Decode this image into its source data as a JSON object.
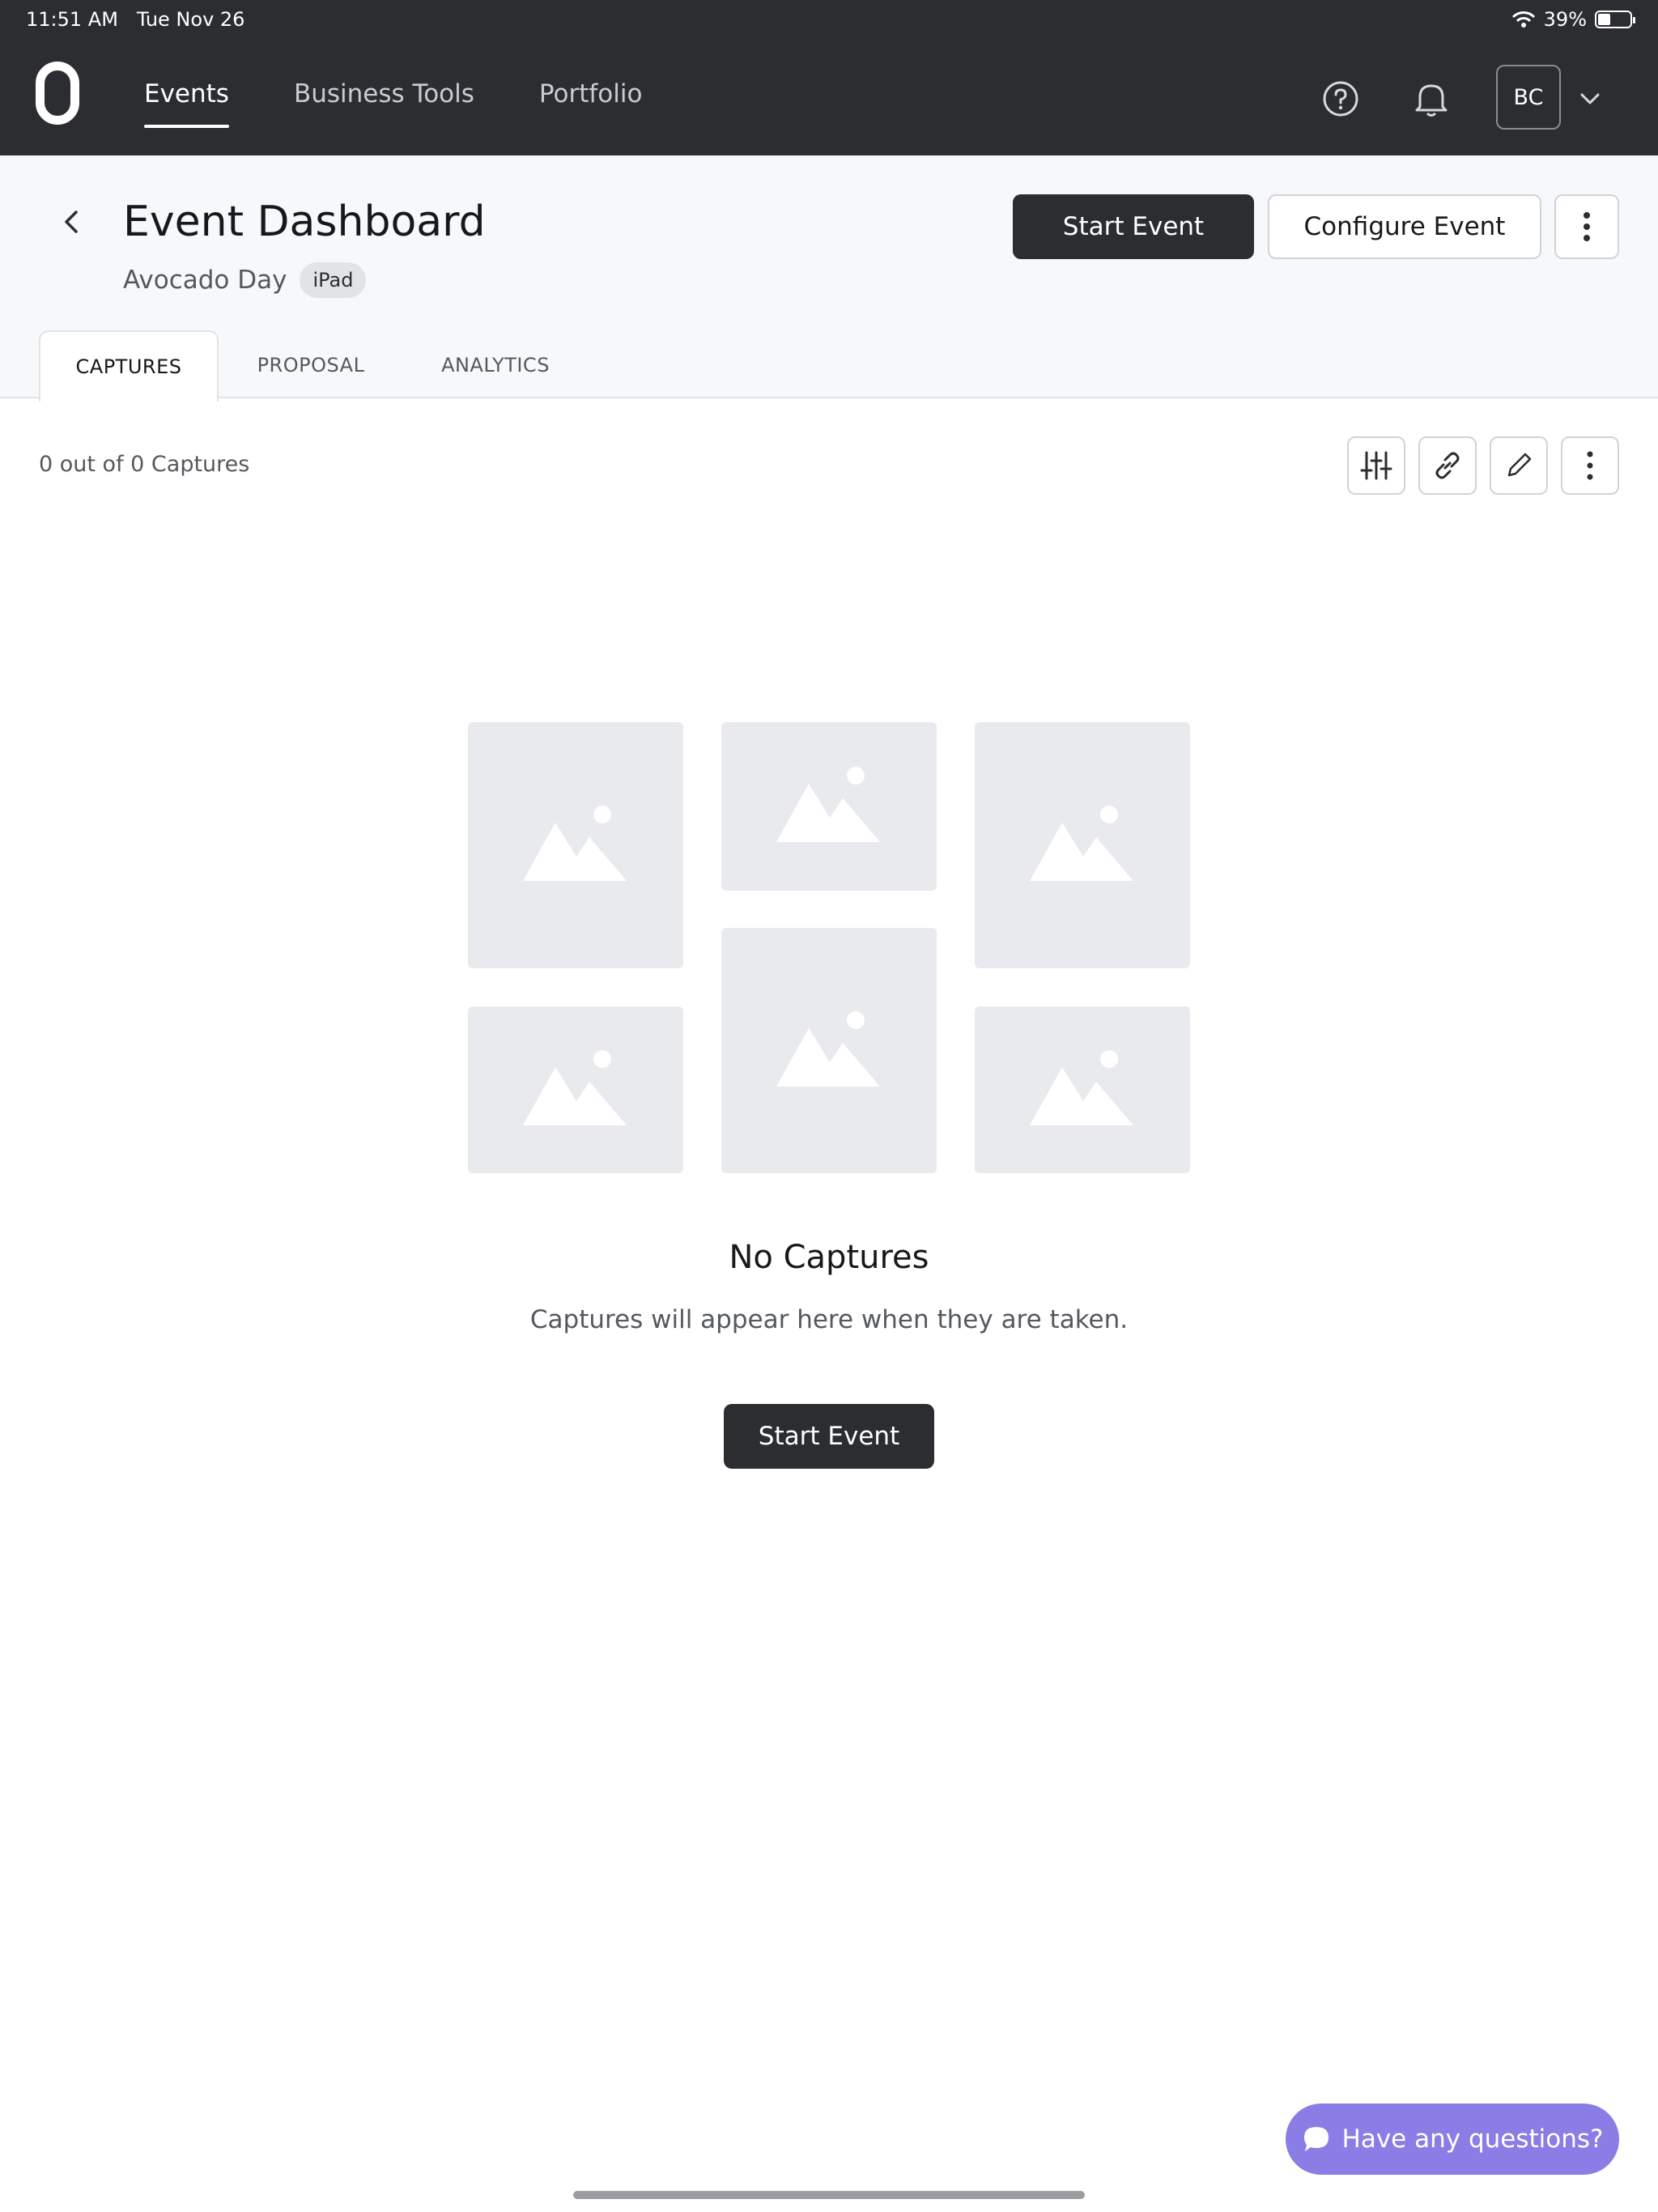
{
  "status_bar": {
    "time": "11:51 AM",
    "date": "Tue Nov 26",
    "battery": "39%",
    "battery_level": 0.39
  },
  "nav": {
    "items": [
      {
        "label": "Events",
        "active": true
      },
      {
        "label": "Business Tools",
        "active": false
      },
      {
        "label": "Portfolio",
        "active": false
      }
    ],
    "avatar_initials": "BC",
    "icons": [
      "help-icon",
      "bell-icon",
      "chevron-down-icon"
    ]
  },
  "header": {
    "title": "Event Dashboard",
    "event_name": "Avocado Day",
    "device_badge": "iPad",
    "start_button": "Start Event",
    "configure_button": "Configure Event"
  },
  "tabs": [
    {
      "label": "CAPTURES",
      "active": true
    },
    {
      "label": "PROPOSAL",
      "active": false
    },
    {
      "label": "ANALYTICS",
      "active": false
    }
  ],
  "toolbar": {
    "capture_count": "0 out of 0 Captures",
    "icons": [
      "sliders-icon",
      "link-icon",
      "pencil-icon",
      "more-vertical-icon"
    ]
  },
  "empty_state": {
    "title": "No Captures",
    "message": "Captures will appear here when they are taken.",
    "button": "Start Event"
  },
  "chat": {
    "label": "Have any questions?"
  },
  "colors": {
    "dark": "#2b2d31",
    "header_bg": "#f7f8fa",
    "placeholder": "#e9eaed",
    "chat": "#8a7ee6"
  }
}
